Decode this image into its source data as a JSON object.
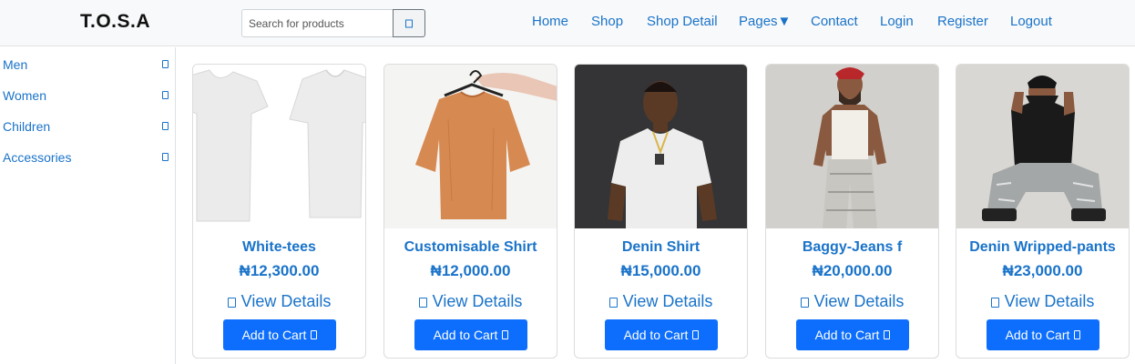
{
  "brand": "T.O.S.A",
  "search": {
    "placeholder": "Search for products"
  },
  "nav": [
    "Home",
    "Shop",
    "Shop Detail",
    "Pages▼",
    "Contact",
    "Login",
    "Register",
    "Logout"
  ],
  "categories": [
    "Men",
    "Women",
    "Children",
    "Accessories"
  ],
  "products": [
    {
      "title": "White-tees",
      "price": "₦12,300.00",
      "view": "View Details",
      "cart": "Add to Cart"
    },
    {
      "title": "Customisable Shirt",
      "price": "₦12,000.00",
      "view": "View Details",
      "cart": "Add to Cart"
    },
    {
      "title": "Denin Shirt",
      "price": "₦15,000.00",
      "view": "View Details",
      "cart": "Add to Cart"
    },
    {
      "title": "Baggy-Jeans f",
      "price": "₦20,000.00",
      "view": "View Details",
      "cart": "Add to Cart"
    },
    {
      "title": "Denin Wripped-pants",
      "price": "₦23,000.00",
      "view": "View Details",
      "cart": "Add to Cart"
    }
  ],
  "colors": {
    "accent": "#1a73c9",
    "button": "#0d6efd"
  }
}
